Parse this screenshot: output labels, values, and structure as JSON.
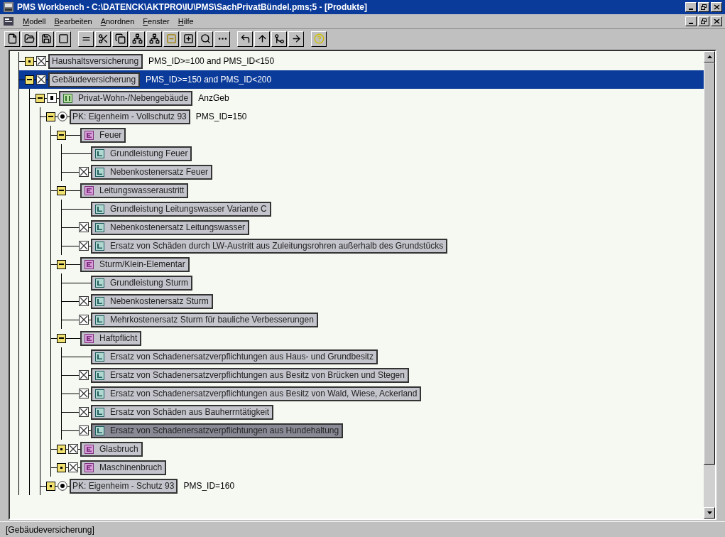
{
  "window": {
    "title": "PMS Workbench - C:\\DATENCK\\AKTPRO\\IU\\PMS\\SachPrivatBündel.pms;5 - [Produkte]"
  },
  "menu": [
    {
      "label": "Modell"
    },
    {
      "label": "Bearbeiten"
    },
    {
      "label": "Anordnen"
    },
    {
      "label": "Fenster"
    },
    {
      "label": "Hilfe"
    }
  ],
  "tree": [
    {
      "label": "Haushaltsversicherung",
      "kind": "product",
      "marker": {
        "kind": "optional"
      },
      "expanded": false,
      "expr": "PMS_ID>=100 and PMS_ID<150",
      "selected": false,
      "highlighted": false
    },
    {
      "label": "Gebäudeversicherung",
      "kind": "product",
      "marker": {
        "kind": "optional"
      },
      "expanded": true,
      "expr": "PMS_ID>=150 and PMS_ID<200",
      "selected": true,
      "highlighted": false,
      "children": [
        {
          "label": "Privat-Wohn-/Nebengebäude",
          "kind": "attribute",
          "marker": {
            "kind": "required"
          },
          "expanded": true,
          "expr": "AnzGeb",
          "selected": false,
          "highlighted": false,
          "children": [
            {
              "label": "PK: Eigenheim - Vollschutz 93",
              "kind": "variant",
              "marker": {
                "kind": "choice"
              },
              "expanded": true,
              "expr": "PMS_ID=150",
              "selected": false,
              "highlighted": false,
              "children": [
                {
                  "label": "Feuer",
                  "kind": "element",
                  "expanded": true,
                  "selected": false,
                  "highlighted": false,
                  "children": [
                    {
                      "label": "Grundleistung Feuer",
                      "kind": "benefit",
                      "selected": false,
                      "highlighted": false
                    },
                    {
                      "label": "Nebenkostenersatz Feuer",
                      "kind": "benefit",
                      "marker": {
                        "kind": "optional"
                      },
                      "selected": false,
                      "highlighted": false
                    }
                  ]
                },
                {
                  "label": "Leitungswasseraustritt",
                  "kind": "element",
                  "expanded": true,
                  "selected": false,
                  "highlighted": false,
                  "children": [
                    {
                      "label": "Grundleistung Leitungswasser Variante C",
                      "kind": "benefit",
                      "selected": false,
                      "highlighted": false
                    },
                    {
                      "label": "Nebenkostenersatz Leitungswasser",
                      "kind": "benefit",
                      "marker": {
                        "kind": "optional"
                      },
                      "selected": false,
                      "highlighted": false
                    },
                    {
                      "label": "Ersatz von Schäden durch LW-Austritt aus Zuleitungsrohren außerhalb des Grundstücks",
                      "kind": "benefit",
                      "marker": {
                        "kind": "optional"
                      },
                      "selected": false,
                      "highlighted": false
                    }
                  ]
                },
                {
                  "label": "Sturm/Klein-Elementar",
                  "kind": "element",
                  "expanded": true,
                  "selected": false,
                  "highlighted": false,
                  "children": [
                    {
                      "label": "Grundleistung Sturm",
                      "kind": "benefit",
                      "selected": false,
                      "highlighted": false
                    },
                    {
                      "label": "Nebenkostenersatz Sturm",
                      "kind": "benefit",
                      "marker": {
                        "kind": "optional"
                      },
                      "selected": false,
                      "highlighted": false
                    },
                    {
                      "label": "Mehrkostenersatz Sturm für bauliche Verbesserungen",
                      "kind": "benefit",
                      "marker": {
                        "kind": "optional"
                      },
                      "selected": false,
                      "highlighted": false
                    }
                  ]
                },
                {
                  "label": "Haftpflicht",
                  "kind": "element",
                  "expanded": true,
                  "selected": false,
                  "highlighted": false,
                  "children": [
                    {
                      "label": "Ersatz von Schadenersatzverpflichtungen aus Haus- und Grundbesitz",
                      "kind": "benefit",
                      "selected": false,
                      "highlighted": false
                    },
                    {
                      "label": "Ersatz von Schadenersatzverpflichtungen aus Besitz von Brücken und Stegen",
                      "kind": "benefit",
                      "marker": {
                        "kind": "optional"
                      },
                      "selected": false,
                      "highlighted": false
                    },
                    {
                      "label": "Ersatz von Schadenersatzverpflichtungen aus Besitz von Wald, Wiese, Ackerland",
                      "kind": "benefit",
                      "marker": {
                        "kind": "optional"
                      },
                      "selected": false,
                      "highlighted": false
                    },
                    {
                      "label": "Ersatz von Schäden aus Bauherrntätigkeit",
                      "kind": "benefit",
                      "marker": {
                        "kind": "optional"
                      },
                      "selected": false,
                      "highlighted": false
                    },
                    {
                      "label": "Ersatz von Schadenersatzverpflichtungen aus Hundehaltung",
                      "kind": "benefit",
                      "marker": {
                        "kind": "optional"
                      },
                      "selected": false,
                      "highlighted": true
                    }
                  ]
                },
                {
                  "label": "Glasbruch",
                  "kind": "element",
                  "marker": {
                    "kind": "optional"
                  },
                  "expanded": false,
                  "selected": false,
                  "highlighted": false
                },
                {
                  "label": "Maschinenbruch",
                  "kind": "element",
                  "marker": {
                    "kind": "optional"
                  },
                  "expanded": false,
                  "selected": false,
                  "highlighted": false
                }
              ]
            },
            {
              "label": "PK: Eigenheim - Schutz 93",
              "kind": "variant",
              "marker": {
                "kind": "choice"
              },
              "expanded": false,
              "expr": "PMS_ID=160",
              "selected": false,
              "highlighted": false
            }
          ]
        }
      ]
    }
  ],
  "status_bar": {
    "text": "[Gebäudeversicherung]"
  }
}
